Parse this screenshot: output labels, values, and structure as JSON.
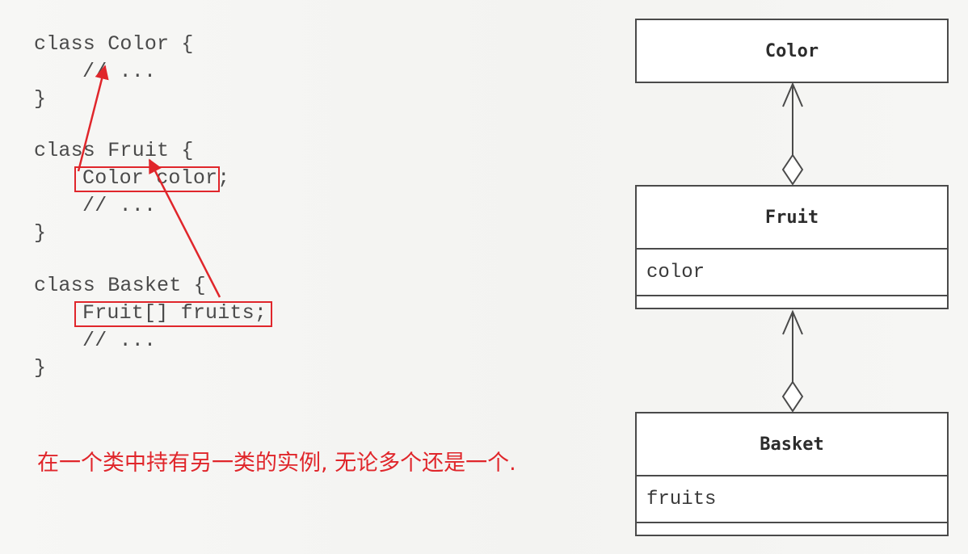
{
  "code": {
    "lines": [
      "class Color {",
      "// ...",
      "}",
      "class Fruit {",
      "Color color;",
      "// ...",
      "}",
      "class Basket {",
      "Fruit[] fruits;",
      "// ...",
      "}"
    ]
  },
  "caption": "在一个类中持有另一类的实例, 无论多个还是一个.",
  "uml": {
    "color_class": {
      "name": "Color"
    },
    "fruit_class": {
      "name": "Fruit",
      "attribute": "color"
    },
    "basket_class": {
      "name": "Basket",
      "attribute": "fruits"
    }
  },
  "colors": {
    "annotation_red": "#e0262b",
    "line_gray": "#4a4a4a"
  }
}
